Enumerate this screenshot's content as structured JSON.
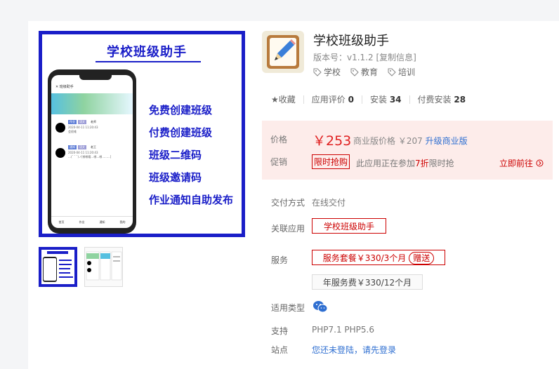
{
  "poster": {
    "title": "学校班级助手",
    "phone_header": "班级助手",
    "item1_tags": [
      "作业",
      "语文"
    ],
    "item1_name": "老师",
    "item1_time": "2020-04-11 11:20:43",
    "item1_text": "会很难",
    "item2_tags": [
      "通知",
      "语文"
    ],
    "item2_name": "老王",
    "item2_time": "2020-04-11 11:20:43",
    "item2_text": "…(ˇ＾ˇ)ノ[哪哪看...哪...哪.........]",
    "tabs": [
      "首页",
      "作业",
      "通知",
      "我的"
    ],
    "features": [
      "免费创建班级",
      "付费创建班级",
      "班级二维码",
      "班级邀请码",
      "作业通知自助发布"
    ]
  },
  "app": {
    "title": "学校班级助手",
    "version": "版本号：v1.1.2 [复制信息]",
    "tags": [
      "学校",
      "教育",
      "培训"
    ]
  },
  "stats": {
    "favorite": "★收藏",
    "rating_label": "应用评价",
    "rating": "0",
    "install_label": "安装",
    "install": "34",
    "paid_install_label": "付费安装",
    "paid_install": "28"
  },
  "pricing": {
    "price_label": "价格",
    "price": "￥253",
    "business_price": "商业版价格 ￥207",
    "upgrade": "升级商业版",
    "promo_label": "促销",
    "flash_sale": "限时抢购",
    "promo_prefix": "此应用正在参加",
    "promo_discount": "7折",
    "promo_suffix": "限时抢",
    "go": "立即前往"
  },
  "details": {
    "delivery_label": "交付方式",
    "delivery": "在线交付",
    "related_label": "关联应用",
    "related": "学校班级助手",
    "service_label": "服务",
    "service_selected": "服务套餐￥330/3个月",
    "gift": "赠送",
    "service_option": "年服务费￥330/12个月",
    "type_label": "适用类型",
    "support_label": "支持",
    "support": "PHP7.1 PHP5.6",
    "site_label": "站点",
    "site": "您还未登陆，请先登录"
  },
  "colors": {
    "poster_blue": "#1a1ec8",
    "price_red": "#e02020",
    "link_blue": "#2f6fd1",
    "price_bg": "#fdecea"
  },
  "icons": {
    "tag": "tag-icon",
    "wechat": "wechat-icon",
    "arrow": "arrow-circle-icon",
    "app": "pencil-notebook-icon"
  }
}
